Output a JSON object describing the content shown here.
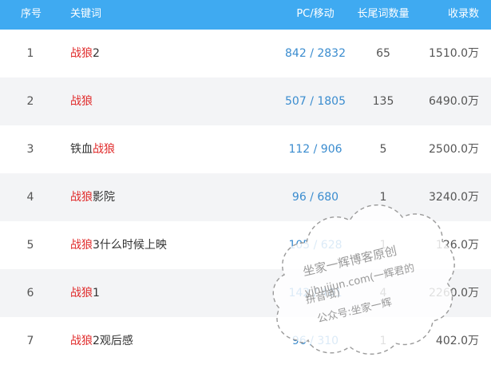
{
  "header": {
    "no": "序号",
    "keyword": "关键词",
    "pc_mobile": "PC/移动",
    "long_tail": "长尾词数量",
    "indexed": "收录数"
  },
  "highlight_term": "战狼",
  "rows": [
    {
      "no": "1",
      "kw_before": "",
      "kw_hl": "战狼",
      "kw_after": "2",
      "pc_mobile": "842 / 2832",
      "long_tail": "65",
      "indexed": "1510.0万"
    },
    {
      "no": "2",
      "kw_before": "",
      "kw_hl": "战狼",
      "kw_after": "",
      "pc_mobile": "507 / 1805",
      "long_tail": "135",
      "indexed": "6490.0万"
    },
    {
      "no": "3",
      "kw_before": "铁血",
      "kw_hl": "战狼",
      "kw_after": "",
      "pc_mobile": "112 / 906",
      "long_tail": "5",
      "indexed": "2500.0万"
    },
    {
      "no": "4",
      "kw_before": "",
      "kw_hl": "战狼",
      "kw_after": "影院",
      "pc_mobile": "96 / 680",
      "long_tail": "1",
      "indexed": "3240.0万"
    },
    {
      "no": "5",
      "kw_before": "",
      "kw_hl": "战狼",
      "kw_after": "3什么时候上映",
      "pc_mobile": "105 / 628",
      "long_tail": "1",
      "indexed": "126.0万"
    },
    {
      "no": "6",
      "kw_before": "",
      "kw_hl": "战狼",
      "kw_after": "1",
      "pc_mobile": "142 / 401",
      "long_tail": "4",
      "indexed": "2260.0万"
    },
    {
      "no": "7",
      "kw_before": "",
      "kw_hl": "战狼",
      "kw_after": "2观后感",
      "pc_mobile": "96 / 310",
      "long_tail": "1",
      "indexed": "402.0万"
    }
  ],
  "watermark": {
    "line1": "坐家一辉博客原创",
    "line2": "yihuijun.com(一辉君的",
    "line3": "拼音哦)",
    "line4": "公众号:坐家一辉"
  },
  "colors": {
    "header_bg": "#3faaf1",
    "highlight": "#e02a2a",
    "link_blue": "#3a8ccf",
    "stripe": "#f3f4f6"
  }
}
